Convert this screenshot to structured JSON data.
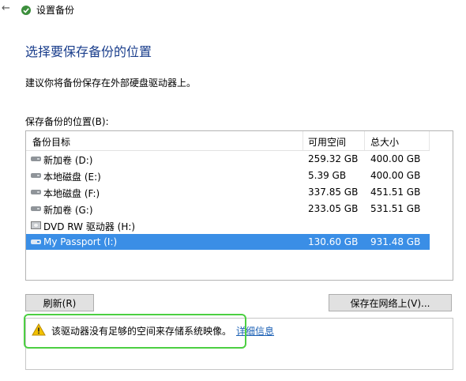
{
  "window": {
    "back_glyph": "←",
    "title": "设置备份"
  },
  "page": {
    "heading": "选择要保存备份的位置",
    "recommendation": "建议你将备份保存在外部硬盘驱动器上。",
    "list_label": "保存备份的位置(B):"
  },
  "table": {
    "columns": [
      "备份目标",
      "可用空间",
      "总大小"
    ],
    "rows": [
      {
        "name": "新加卷 (D:)",
        "free": "259.32 GB",
        "total": "400.00 GB",
        "icon": "hard-drive-icon",
        "selected": false
      },
      {
        "name": "本地磁盘 (E:)",
        "free": "5.39 GB",
        "total": "400.00 GB",
        "icon": "hard-drive-icon",
        "selected": false
      },
      {
        "name": "本地磁盘 (F:)",
        "free": "337.85 GB",
        "total": "451.51 GB",
        "icon": "hard-drive-icon",
        "selected": false
      },
      {
        "name": "新加卷 (G:)",
        "free": "233.05 GB",
        "total": "531.51 GB",
        "icon": "hard-drive-icon",
        "selected": false
      },
      {
        "name": "DVD RW 驱动器 (H:)",
        "free": "",
        "total": "",
        "icon": "dvd-drive-icon",
        "selected": false
      },
      {
        "name": "My Passport (I:)",
        "free": "130.60 GB",
        "total": "931.48 GB",
        "icon": "hard-drive-icon",
        "selected": true
      }
    ]
  },
  "buttons": {
    "refresh": "刷新(R)",
    "save_network": "保存在网络上(V)..."
  },
  "warning": {
    "message": "该驱动器没有足够的空间来存储系统映像。",
    "link": "详细信息",
    "icon": "warning-icon"
  },
  "colors": {
    "heading": "#1a3e8c",
    "selection": "#3a8ee6",
    "highlight": "#4ccf42",
    "link": "#1a5fb4"
  }
}
